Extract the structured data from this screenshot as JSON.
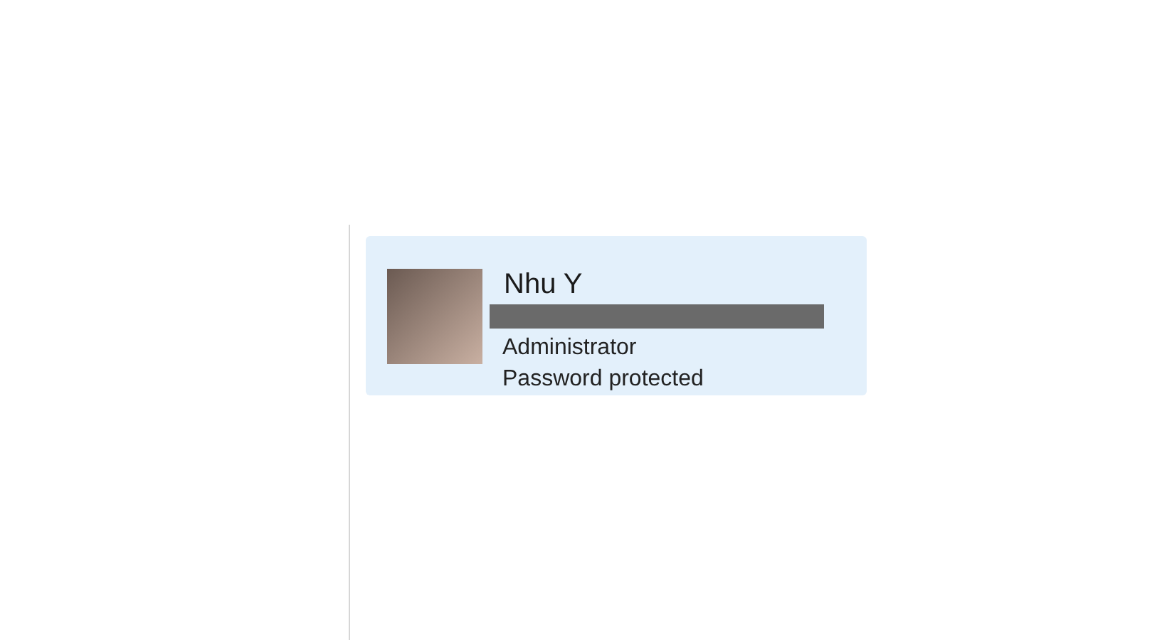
{
  "account_card": {
    "name": "Nhu Y",
    "email_redacted": true,
    "role": "Administrator",
    "sign_in": "Password protected"
  }
}
